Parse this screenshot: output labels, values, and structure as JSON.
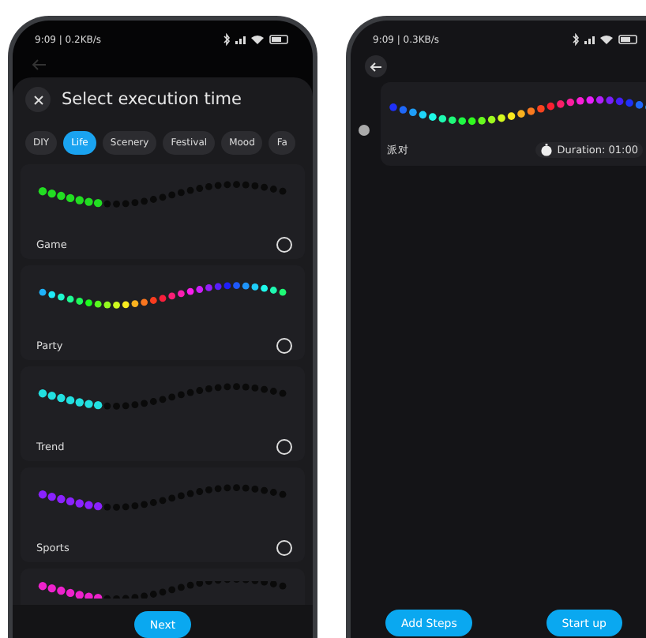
{
  "left_screen": {
    "status_bar": {
      "time": "9:09 | 0.2KB/s"
    },
    "sheet": {
      "title": "Select execution time"
    },
    "tabs": [
      {
        "label": "DIY",
        "selected": false
      },
      {
        "label": "Life",
        "selected": true
      },
      {
        "label": "Scenery",
        "selected": false
      },
      {
        "label": "Festival",
        "selected": false
      },
      {
        "label": "Mood",
        "selected": false
      },
      {
        "label": "Fa",
        "selected": false
      }
    ],
    "effects": [
      {
        "label": "Game",
        "kind": "partial",
        "color": "#22dd22",
        "selected": false
      },
      {
        "label": "Party",
        "kind": "rainbow",
        "selected": false
      },
      {
        "label": "Trend",
        "kind": "partial",
        "color": "#22e0e0",
        "selected": false
      },
      {
        "label": "Sports",
        "kind": "partial",
        "color": "#8a22ff",
        "selected": false
      },
      {
        "kind": "partial",
        "color": "#ee22cc"
      }
    ],
    "next_button": "Next"
  },
  "right_screen": {
    "status_bar": {
      "time": "9:09 | 0.3KB/s"
    },
    "step": {
      "name": "派对",
      "duration": "Duration: 01:00"
    },
    "buttons": [
      "Add Steps",
      "Start up"
    ]
  }
}
